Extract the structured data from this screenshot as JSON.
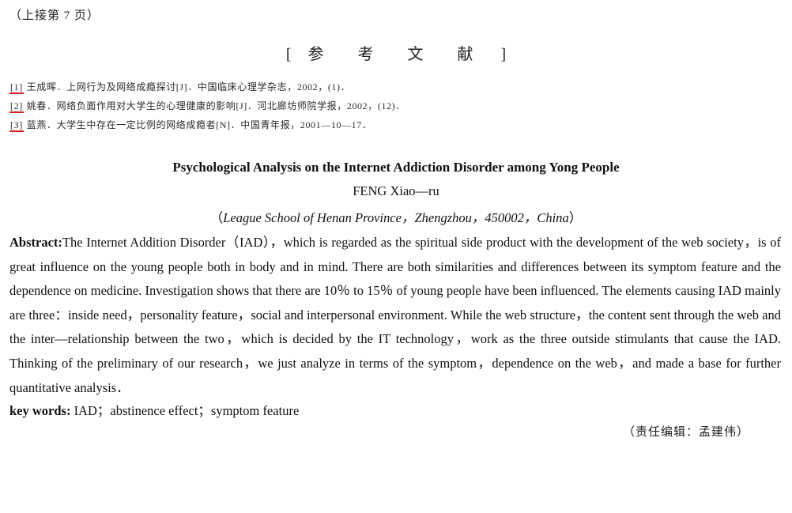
{
  "continued_note": "（上接第 7 页）",
  "references": {
    "heading_open": "[",
    "heading_text": "参 考 文 献",
    "heading_close": "]",
    "items": [
      {
        "num": "[1]",
        "text": "王成晖．上网行为及网络成瘾探讨[J]．中国临床心理学杂志，2002，(1)．"
      },
      {
        "num": "[2]",
        "text": "姚春．网络负面作用对大学生的心理健康的影响[J]．河北廊坊师院学报，2002，(12)．"
      },
      {
        "num": "[3]",
        "text": "蓝燕．大学生中存在一定比例的网络成瘾者[N]．中国青年报，2001—10—17．"
      }
    ]
  },
  "paper": {
    "title": "Psychological Analysis on the Internet Addiction Disorder among Yong People",
    "author": "FENG Xiao—ru",
    "affiliation_open": "（",
    "affiliation_text": "League School of Henan Province，Zhengzhou，450002，China",
    "affiliation_close": "）",
    "abstract_label": "Abstract:",
    "abstract_text": "The Internet Addition Disorder（IAD），which is regarded as the spiritual side product with the development of the web society，is of great influence on the young people both in body and in mind. There are both similarities and differences between its symptom feature and the dependence on medicine. Investigation shows that there are 10％ to 15％ of young people have been influenced. The elements causing IAD mainly are three：inside need，personality feature，social and interpersonal environment. While the web structure，the content sent through the web and the inter—relationship between the two，which is decided by the IT technology，work as the three outside stimulants that cause the IAD. Thinking of the preliminary of our research，we just analyze in terms of the symptom，dependence on the web，and made a base for further quantitative analysis．",
    "keywords_label": "key words:",
    "keywords_text": "IAD；abstinence effect；symptom feature"
  },
  "editor_note": "（责任编辑：孟建伟）"
}
